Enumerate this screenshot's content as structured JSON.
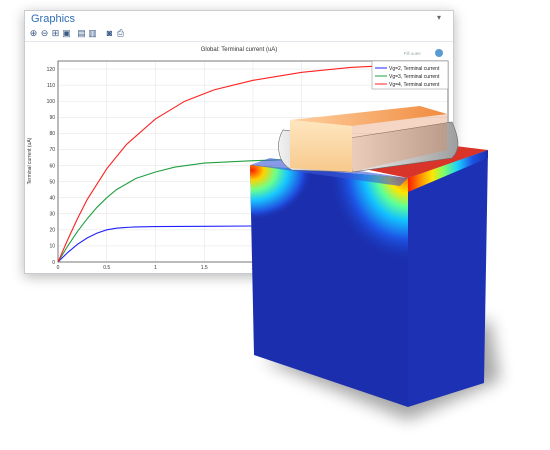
{
  "window": {
    "title": "Graphics",
    "toolbar_icons": [
      "zoom-in-icon",
      "zoom-out-icon",
      "zoom-extents-icon",
      "zoom-box-icon",
      "table-icon",
      "legend-icon",
      "camera-icon",
      "print-icon"
    ]
  },
  "plot_title": "Global: Terminal current (uA)",
  "watermark": "Fill outer",
  "chart_data": {
    "type": "line",
    "title": "Global: Terminal current (uA)",
    "xlabel": "Vd",
    "ylabel": "Terminal current (uA)",
    "xlim": [
      0,
      4
    ],
    "ylim": [
      0,
      125
    ],
    "xticks": [
      "0",
      "0.5",
      "1",
      "1.5",
      "2",
      "2.5"
    ],
    "yticks": [
      "0",
      "10",
      "20",
      "30",
      "40",
      "50",
      "60",
      "70",
      "80",
      "90",
      "100",
      "110",
      "120"
    ],
    "grid": true,
    "legend_position": "top-right",
    "series": [
      {
        "name": "Vg=2, Terminal current",
        "color": "#2020ff",
        "x": [
          0,
          0.1,
          0.2,
          0.3,
          0.4,
          0.5,
          0.6,
          0.7,
          0.8,
          1.0,
          1.5,
          2.0,
          2.5,
          3.0,
          3.5,
          4.0
        ],
        "y": [
          0,
          6,
          11,
          15,
          18,
          20,
          21,
          21.5,
          21.8,
          22,
          22.2,
          22.4,
          22.6,
          22.8,
          23,
          23.2
        ]
      },
      {
        "name": "Vg=3, Terminal current",
        "color": "#20a040",
        "x": [
          0,
          0.1,
          0.2,
          0.3,
          0.4,
          0.5,
          0.6,
          0.8,
          1.0,
          1.2,
          1.5,
          2.0,
          2.5,
          3.0,
          3.5,
          4.0
        ],
        "y": [
          0,
          10,
          19,
          27,
          34,
          40,
          45,
          52,
          56,
          59,
          61.5,
          63,
          64,
          64.5,
          65,
          65.3
        ]
      },
      {
        "name": "Vg=4, Terminal current",
        "color": "#ff2020",
        "x": [
          0,
          0.1,
          0.2,
          0.3,
          0.5,
          0.7,
          1.0,
          1.3,
          1.6,
          2.0,
          2.5,
          3.0,
          3.5,
          4.0
        ],
        "y": [
          0,
          14,
          27,
          39,
          58,
          73,
          89,
          100,
          107,
          113,
          118,
          121,
          122.5,
          123.5
        ]
      }
    ]
  }
}
